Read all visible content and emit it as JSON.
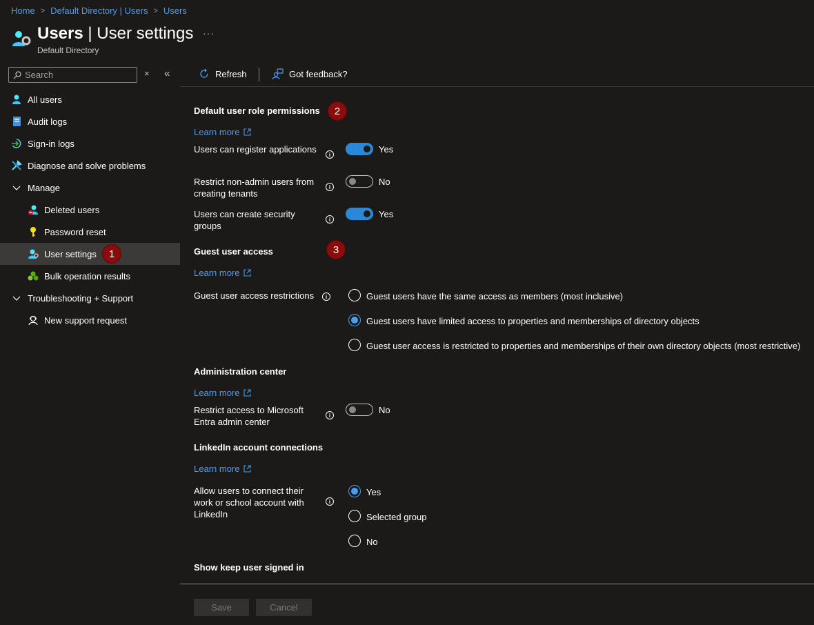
{
  "breadcrumb": {
    "home": "Home",
    "directory": "Default Directory | Users",
    "users": "Users"
  },
  "header": {
    "title_main": "Users",
    "title_rest": "| User settings",
    "subtitle": "Default Directory",
    "more": "···"
  },
  "sidebar": {
    "search_placeholder": "Search",
    "clear": "×",
    "collapse": "«",
    "items": [
      {
        "label": "All users"
      },
      {
        "label": "Audit logs"
      },
      {
        "label": "Sign-in logs"
      },
      {
        "label": "Diagnose and solve problems"
      },
      {
        "label": "Manage"
      },
      {
        "label": "Deleted users"
      },
      {
        "label": "Password reset"
      },
      {
        "label": "User settings"
      },
      {
        "label": "Bulk operation results"
      },
      {
        "label": "Troubleshooting + Support"
      },
      {
        "label": "New support request"
      }
    ]
  },
  "badges": [
    "1",
    "2",
    "3"
  ],
  "toolbar": {
    "refresh": "Refresh",
    "feedback": "Got feedback?"
  },
  "sections": {
    "default_role": {
      "title": "Default user role permissions",
      "learn_more": "Learn more",
      "settings": [
        {
          "label": "Users can register applications",
          "value": "Yes",
          "on": true
        },
        {
          "label": "Restrict non-admin users from creating tenants",
          "value": "No",
          "on": false
        },
        {
          "label": "Users can create security groups",
          "value": "Yes",
          "on": true
        }
      ]
    },
    "guest": {
      "title": "Guest user access",
      "learn_more": "Learn more",
      "label": "Guest user access restrictions",
      "options": [
        "Guest users have the same access as members (most inclusive)",
        "Guest users have limited access to properties and memberships of directory objects",
        "Guest user access is restricted to properties and memberships of their own directory objects (most restrictive)"
      ],
      "selected_index": 1
    },
    "admin_center": {
      "title": "Administration center",
      "learn_more": "Learn more",
      "label": "Restrict access to Microsoft Entra admin center",
      "value": "No",
      "on": false
    },
    "linkedin": {
      "title": "LinkedIn account connections",
      "learn_more": "Learn more",
      "label": "Allow users to connect their work or school account with LinkedIn",
      "options": [
        "Yes",
        "Selected group",
        "No"
      ],
      "selected_index": 0
    },
    "keep_signed_in": {
      "title": "Show keep user signed in"
    }
  },
  "footer": {
    "save": "Save",
    "cancel": "Cancel"
  },
  "colors": {
    "accent": "#479ef5",
    "toggle_on": "#2b88d8",
    "badge": "#8b0c0c",
    "background": "#1b1a19"
  }
}
